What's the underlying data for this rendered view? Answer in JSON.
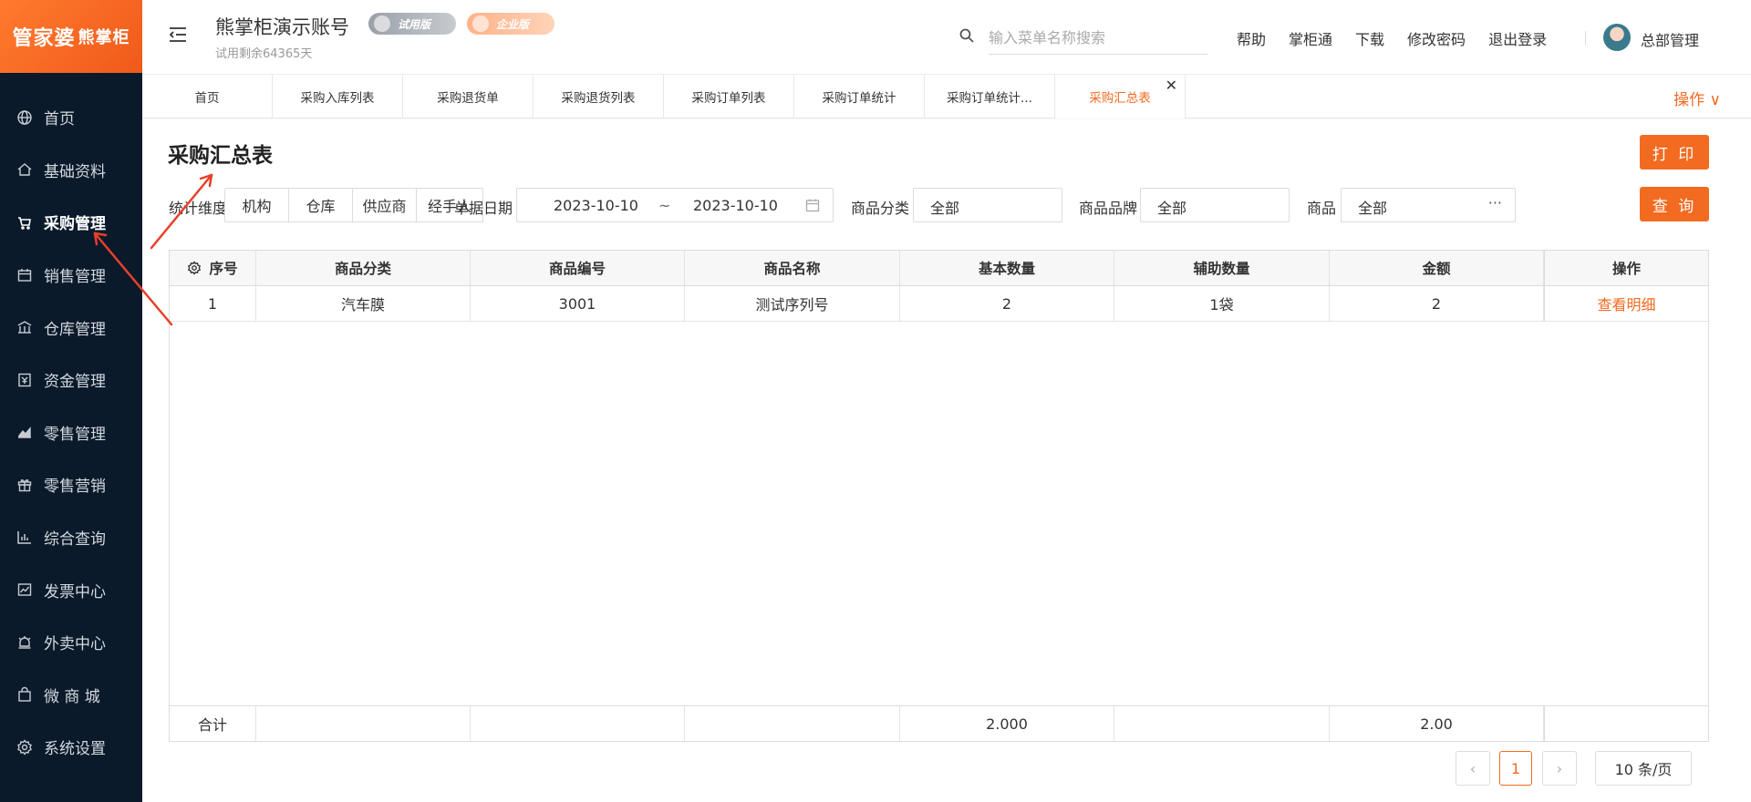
{
  "brand": {
    "name": "管家婆",
    "sub": "熊掌柜"
  },
  "sidebar": {
    "items": [
      {
        "label": "首页",
        "icon": "globe-icon"
      },
      {
        "label": "基础资料",
        "icon": "home-icon"
      },
      {
        "label": "采购管理",
        "icon": "cart-icon"
      },
      {
        "label": "销售管理",
        "icon": "calendar-icon"
      },
      {
        "label": "仓库管理",
        "icon": "warehouse-icon"
      },
      {
        "label": "资金管理",
        "icon": "money-icon"
      },
      {
        "label": "零售管理",
        "icon": "chart-icon"
      },
      {
        "label": "零售营销",
        "icon": "gift-icon"
      },
      {
        "label": "综合查询",
        "icon": "bar-chart-icon"
      },
      {
        "label": "发票中心",
        "icon": "trend-icon"
      },
      {
        "label": "外卖中心",
        "icon": "bell-icon"
      },
      {
        "label": "微 商 城",
        "icon": "bag-icon"
      },
      {
        "label": "系统设置",
        "icon": "gear-icon"
      }
    ]
  },
  "header": {
    "account_name": "熊掌柜演示账号",
    "trial_badge": "试用版",
    "enterprise_badge": "企业版",
    "trial_days": "试用剩余64365天",
    "search_placeholder": "输入菜单名称搜索",
    "links": [
      "帮助",
      "掌柜通",
      "下载",
      "修改密码",
      "退出登录"
    ],
    "user_name": "总部管理"
  },
  "tabs": {
    "items": [
      "首页",
      "采购入库列表",
      "采购退货单",
      "采购退货列表",
      "采购订单列表",
      "采购订单统计",
      "采购订单统计...",
      "采购汇总表"
    ],
    "active_index": 7,
    "ops_label": "操作 ∨"
  },
  "page": {
    "title": "采购汇总表",
    "print_button": "打 印",
    "query_button": "查 询"
  },
  "filters": {
    "dimension_label": "统计维度",
    "dimensions": [
      "机构",
      "仓库",
      "供应商",
      "经手人"
    ],
    "date_label": "单据日期",
    "date_start": "2023-10-10",
    "date_sep": "~",
    "date_end": "2023-10-10",
    "category_label": "商品分类",
    "category_value": "全部",
    "brand_label": "商品品牌",
    "brand_value": "全部",
    "product_label": "商品",
    "product_value": "全部",
    "product_more": "···"
  },
  "table": {
    "headers": [
      "序号",
      "商品分类",
      "商品编号",
      "商品名称",
      "基本数量",
      "辅助数量",
      "金额",
      "操作"
    ],
    "rows": [
      {
        "index": "1",
        "category": "汽车膜",
        "code": "3001",
        "name": "测试序列号",
        "base_qty": "2",
        "aux_qty": "1袋",
        "amount": "2",
        "action": "查看明细"
      }
    ],
    "total": {
      "label": "合计",
      "base_qty": "2.000",
      "amount": "2.00"
    }
  },
  "pagination": {
    "prev": "‹",
    "current": "1",
    "next": "›",
    "page_size": "10 条/页"
  },
  "colors": {
    "accent": "#f26b21",
    "sidebar_bg": "#0a1a2b",
    "annotation": "#e8402a"
  }
}
